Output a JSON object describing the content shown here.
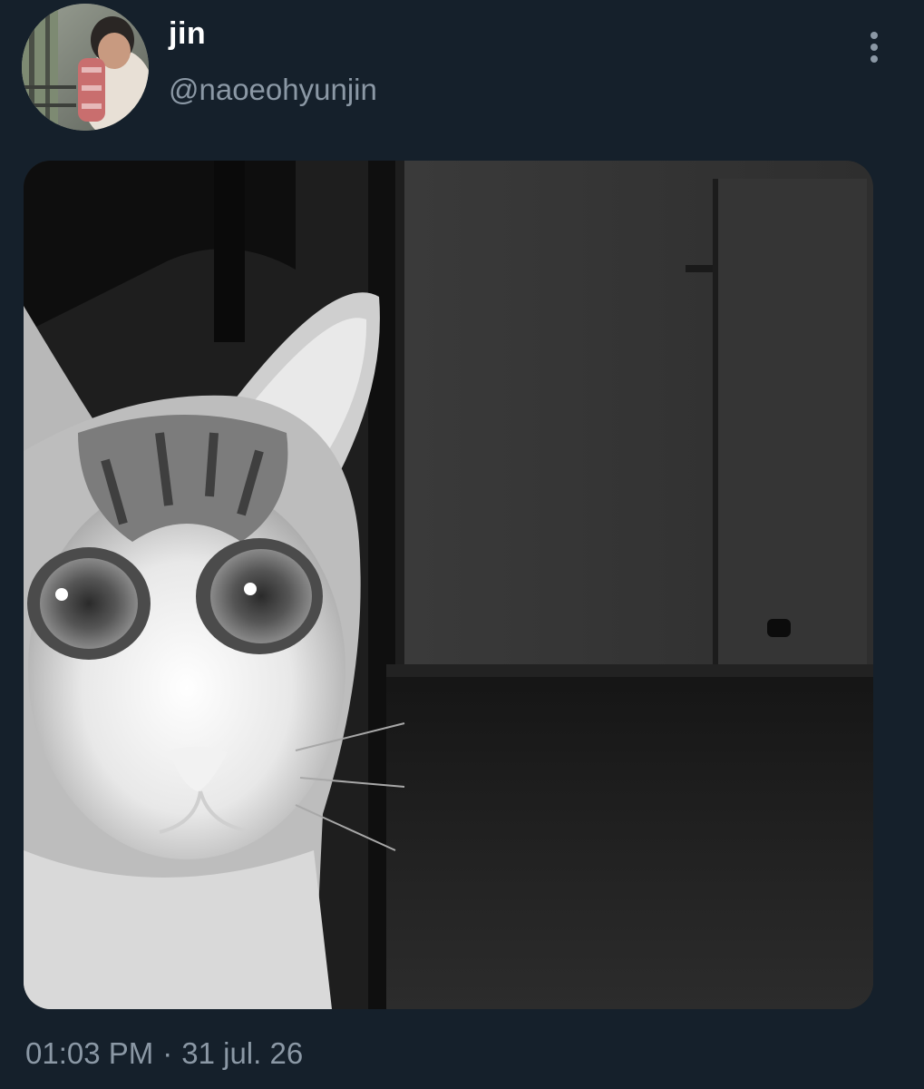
{
  "tweet": {
    "author": {
      "display_name": "jin",
      "handle": "@naoeohyunjin",
      "avatar_icon": "user-avatar"
    },
    "more_icon": "more-vertical-icon",
    "media": {
      "kind": "photo",
      "subject": "grayscale cat photo"
    },
    "time": "01:03 PM",
    "separator": "·",
    "date": "31 jul. 26"
  },
  "colors": {
    "background": "#15202b",
    "primary_text": "#ffffff",
    "secondary_text": "#8b98a5"
  }
}
